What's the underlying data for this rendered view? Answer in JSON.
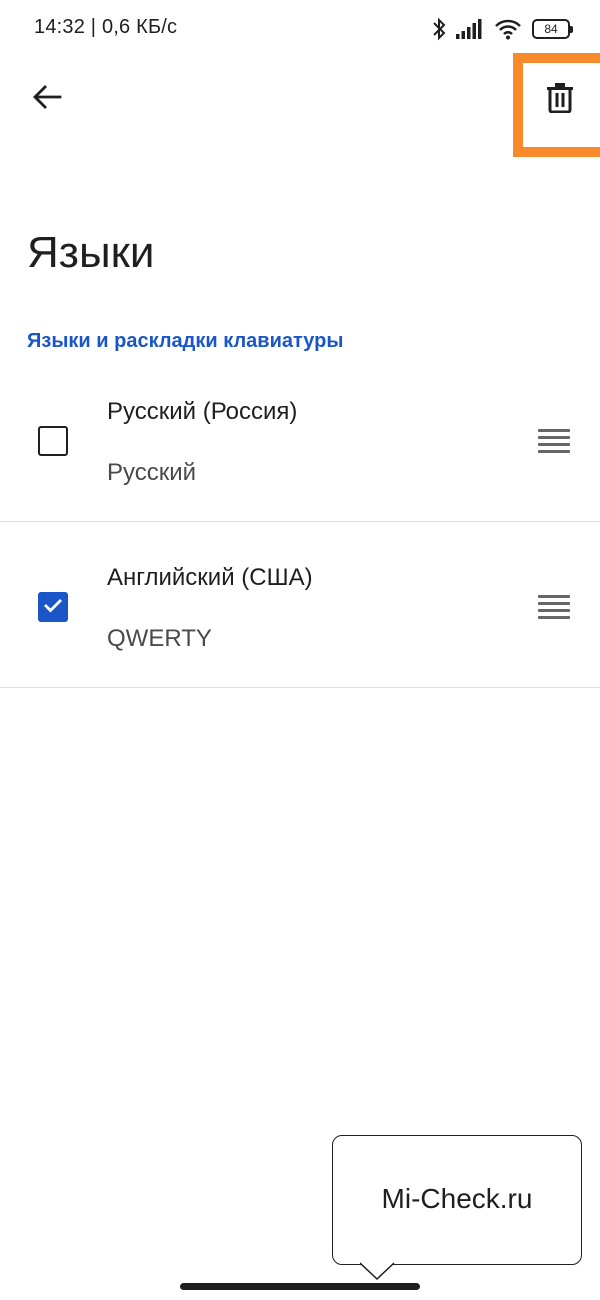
{
  "status_bar": {
    "time": "14:32 | 0,6 КБ/с",
    "battery": "84",
    "icons": [
      "bluetooth-icon",
      "signal-icon",
      "wifi-icon",
      "battery-icon"
    ]
  },
  "app_bar": {
    "back_icon": "arrow-left-icon",
    "delete_icon": "trash-icon",
    "highlight_color": "#f98a2c"
  },
  "page": {
    "title": "Языки",
    "section_header": "Языки и раскладки клавиатуры"
  },
  "languages": [
    {
      "name": "Русский (Россия)",
      "layout": "Русский",
      "checked": false
    },
    {
      "name": "Английский (США)",
      "layout": "QWERTY",
      "checked": true
    }
  ],
  "watermark": {
    "text": "Mi-Check.ru"
  },
  "colors": {
    "accent": "#1a56c8",
    "text": "#1f1f1f"
  }
}
